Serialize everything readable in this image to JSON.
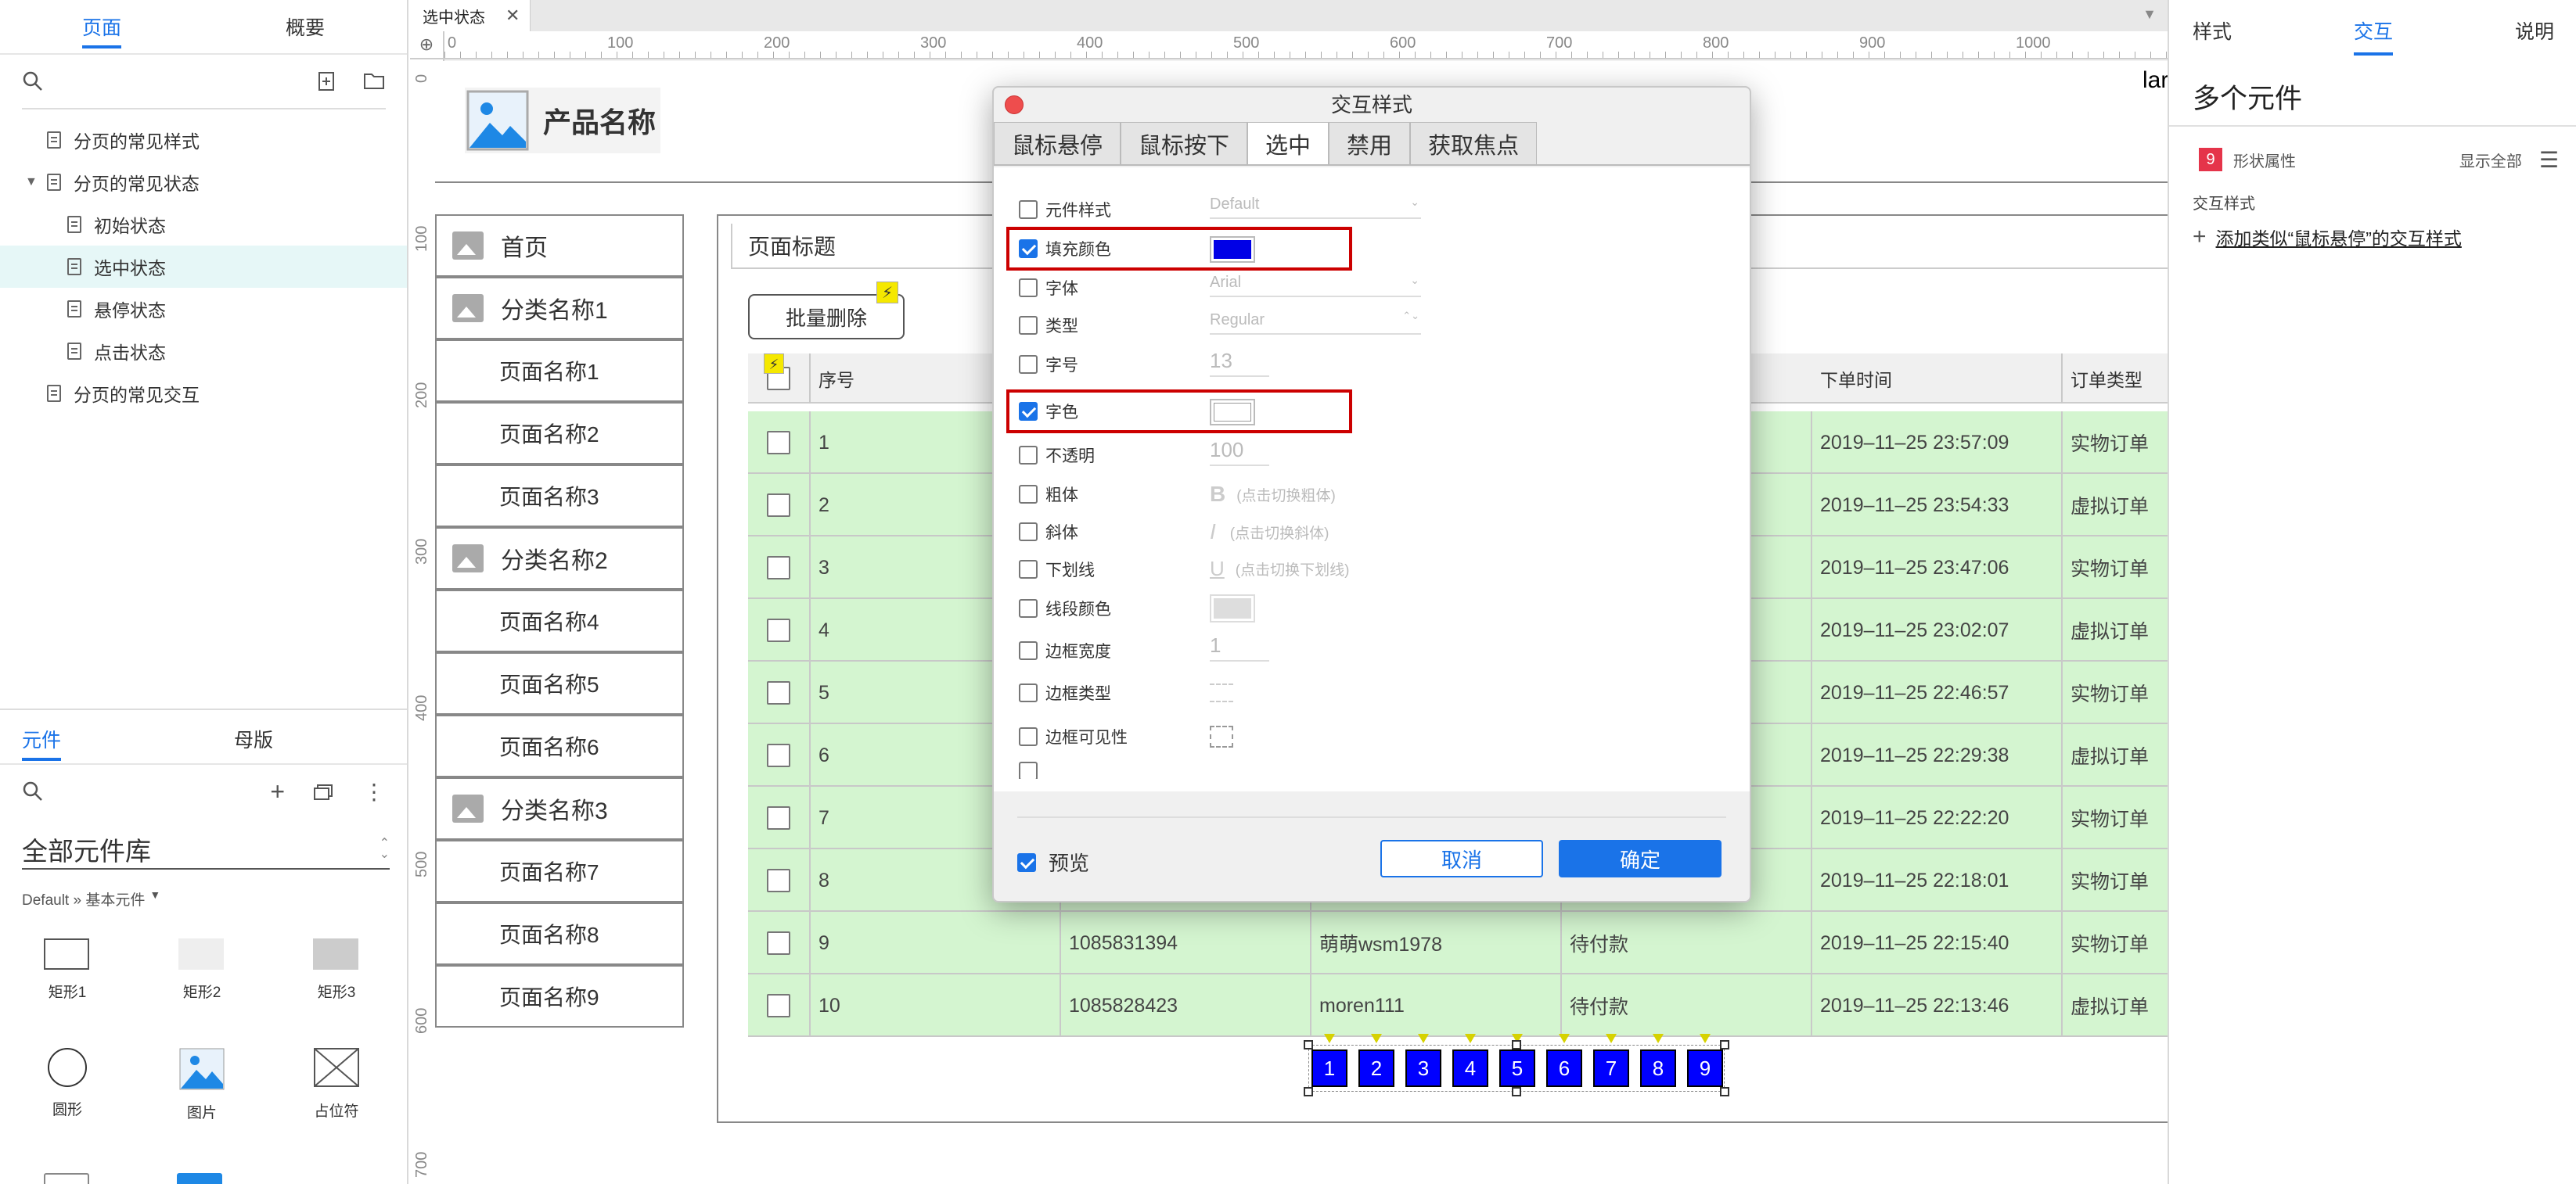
{
  "left_panel": {
    "tabs": [
      "页面",
      "概要"
    ],
    "tree": [
      {
        "label": "分页的常见样式",
        "level": 1
      },
      {
        "label": "分页的常见状态",
        "level": 1
      },
      {
        "label": "初始状态",
        "level": 2
      },
      {
        "label": "选中状态",
        "level": 2
      },
      {
        "label": "悬停状态",
        "level": 2
      },
      {
        "label": "点击状态",
        "level": 2
      },
      {
        "label": "分页的常见交互",
        "level": 1
      }
    ],
    "widget_tabs": [
      "元件",
      "母版"
    ],
    "library_title": "全部元件库",
    "library_sub": "Default » 基本元件",
    "widgets": [
      "矩形1",
      "矩形2",
      "矩形3",
      "圆形",
      "图片",
      "占位符"
    ]
  },
  "canvas": {
    "doc_tab": "选中状态",
    "ruler_h": [
      "0",
      "100",
      "200",
      "300",
      "400",
      "500",
      "600",
      "700",
      "800",
      "900",
      "1000"
    ],
    "ruler_v": [
      "0",
      "100",
      "200",
      "300",
      "400",
      "500",
      "600",
      "700"
    ],
    "product_name": "产品名称",
    "top_right_text": "lar",
    "nav": {
      "home": "首页",
      "cat1": "分类名称1",
      "cat2": "分类名称2",
      "cat3": "分类名称3",
      "pages": [
        "页面名称1",
        "页面名称2",
        "页面名称3",
        "页面名称4",
        "页面名称5",
        "页面名称6",
        "页面名称7",
        "页面名称8",
        "页面名称9"
      ]
    },
    "page_title": "页面标题",
    "batch_delete": "批量删除",
    "table": {
      "headers": {
        "seq": "序号",
        "time": "下单时间",
        "type": "订单类型"
      },
      "rows": [
        {
          "seq": "1",
          "order": "",
          "user": "",
          "status": "",
          "time": "2019–11–25 23:57:09",
          "type": "实物订单"
        },
        {
          "seq": "2",
          "order": "",
          "user": "",
          "status": "",
          "time": "2019–11–25 23:54:33",
          "type": "虚拟订单"
        },
        {
          "seq": "3",
          "order": "",
          "user": "",
          "status": "",
          "time": "2019–11–25 23:47:06",
          "type": "实物订单"
        },
        {
          "seq": "4",
          "order": "",
          "user": "",
          "status": "",
          "time": "2019–11–25 23:02:07",
          "type": "虚拟订单"
        },
        {
          "seq": "5",
          "order": "",
          "user": "",
          "status": "",
          "time": "2019–11–25 22:46:57",
          "type": "实物订单"
        },
        {
          "seq": "6",
          "order": "",
          "user": "",
          "status": "",
          "time": "2019–11–25 22:29:38",
          "type": "虚拟订单"
        },
        {
          "seq": "7",
          "order": "",
          "user": "",
          "status": "",
          "time": "2019–11–25 22:22:20",
          "type": "实物订单"
        },
        {
          "seq": "8",
          "order": "",
          "user": "",
          "status": "",
          "time": "2019–11–25 22:18:01",
          "type": "实物订单"
        },
        {
          "seq": "9",
          "order": "1085831394",
          "user": "萌萌wsm1978",
          "status": "待付款",
          "time": "2019–11–25 22:15:40",
          "type": "实物订单"
        },
        {
          "seq": "10",
          "order": "1085828423",
          "user": "moren111",
          "status": "待付款",
          "time": "2019–11–25 22:13:46",
          "type": "虚拟订单"
        }
      ]
    },
    "pagination": [
      "1",
      "2",
      "3",
      "4",
      "5",
      "6",
      "7",
      "8",
      "9"
    ]
  },
  "dialog": {
    "title": "交互样式",
    "tabs": [
      "鼠标悬停",
      "鼠标按下",
      "选中",
      "禁用",
      "获取焦点"
    ],
    "props": [
      {
        "label": "元件样式",
        "value": "Default",
        "checked": false
      },
      {
        "label": "填充颜色",
        "value": "",
        "checked": true
      },
      {
        "label": "字体",
        "value": "Arial",
        "checked": false
      },
      {
        "label": "类型",
        "value": "Regular",
        "checked": false
      },
      {
        "label": "字号",
        "value": "13",
        "checked": false
      },
      {
        "label": "字色",
        "value": "",
        "checked": true
      },
      {
        "label": "不透明",
        "value": "100",
        "checked": false
      },
      {
        "label": "粗体",
        "value": "(点击切换粗体)",
        "checked": false
      },
      {
        "label": "斜体",
        "value": "(点击切换斜体)",
        "checked": false
      },
      {
        "label": "下划线",
        "value": "(点击切换下划线)",
        "checked": false
      },
      {
        "label": "线段颜色",
        "value": "",
        "checked": false
      },
      {
        "label": "边框宽度",
        "value": "1",
        "checked": false
      },
      {
        "label": "边框类型",
        "value": "",
        "checked": false
      },
      {
        "label": "边框可见性",
        "value": "",
        "checked": false
      }
    ],
    "preview": "预览",
    "cancel": "取消",
    "ok": "确定",
    "fill_color": "#0000e6",
    "font_color": "#ffffff"
  },
  "right_panel": {
    "tabs": [
      "样式",
      "交互",
      "说明"
    ],
    "title": "多个元件",
    "badge": "9",
    "shape_props": "形状属性",
    "show_all": "显示全部",
    "section": "交互样式",
    "add_link": "添加类似“鼠标悬停”的交互样式"
  }
}
